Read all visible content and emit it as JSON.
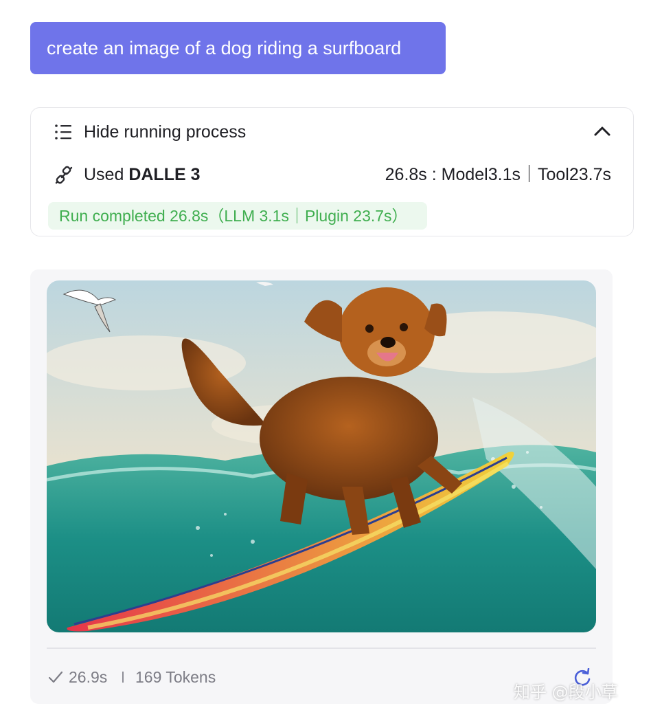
{
  "chat": {
    "user_message": "create an image of a dog riding a surfboard"
  },
  "process": {
    "toggle_label": "Hide running process",
    "tool_used_prefix": "Used",
    "tool_name": "DALLE 3",
    "timing": "26.8s : Model3.1s｜Tool23.7s",
    "run_status": "Run completed 26.8s（LLM 3.1s｜Plugin 23.7s）",
    "icons": {
      "toggle": "list-icon",
      "collapse": "chevron-up-icon",
      "tool": "link-icon"
    }
  },
  "result": {
    "elapsed": "26.9s",
    "tokens": "169 Tokens",
    "icons": {
      "status": "check-icon",
      "regenerate": "refresh-icon"
    }
  },
  "watermark": "知乎 @段小草",
  "colors": {
    "user_bubble": "#6f74ea",
    "run_badge_bg": "#ecf8ee",
    "run_badge_text": "#3fae4f",
    "regenerate_icon": "#4a5fd8"
  }
}
